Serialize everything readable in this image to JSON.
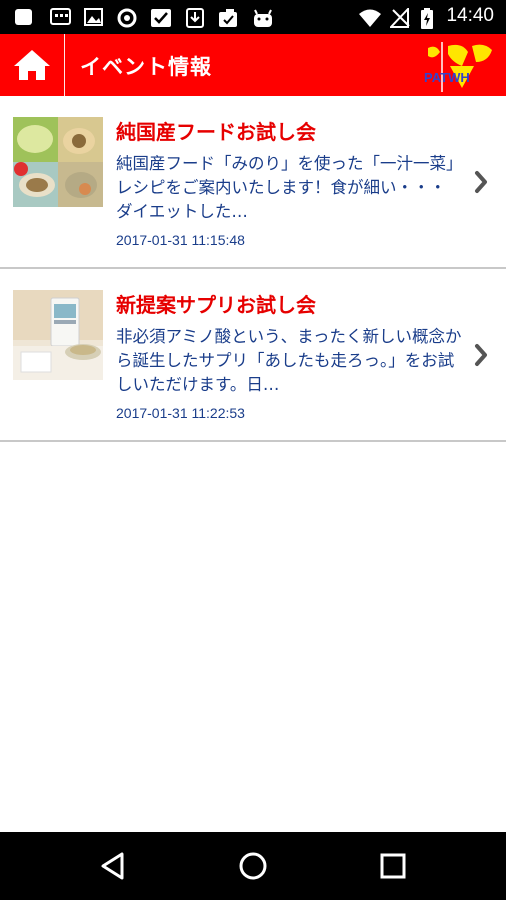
{
  "status_bar": {
    "time": "14:40",
    "icons": [
      "notification-icon",
      "chat-icon",
      "image-icon",
      "vpn-icon",
      "check-icon",
      "download-icon",
      "clipboard-icon",
      "android-icon",
      "wifi-icon",
      "no-signal-icon",
      "battery-charging-icon"
    ]
  },
  "header": {
    "title": "イベント情報",
    "home_icon": "home-icon",
    "logo_text": "PATWH"
  },
  "events": [
    {
      "title": "純国産フードお試し会",
      "description": "純国産フード「みのり」を使った「一汁一菜」レシピをご案内いたします！食が細い・・・　ダイエットした…",
      "date": "2017-01-31 11:15:48"
    },
    {
      "title": "新提案サプリお試し会",
      "description": "非必須アミノ酸という、まったく新しい概念から誕生したサプリ「あしたも走ろっ。」をお試しいただけます。日…",
      "date": "2017-01-31 11:22:53"
    }
  ],
  "colors": {
    "header_bg": "#ff0000",
    "title_red": "#e60000",
    "body_blue": "#1a3d8a",
    "divider": "#c8c8c8"
  },
  "nav_bar": {
    "icons": [
      "back-icon",
      "home-circle-icon",
      "recents-icon"
    ]
  }
}
